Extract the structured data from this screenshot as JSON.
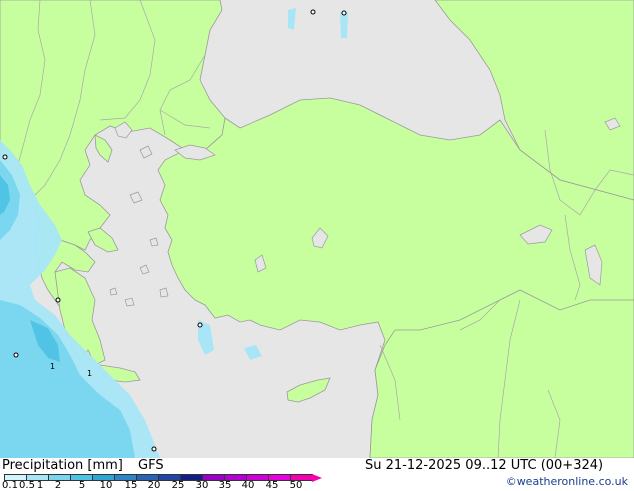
{
  "legend": {
    "title": "Precipitation [mm]",
    "model": "GFS",
    "valid_time": "Su 21-12-2025 09..12 UTC (00+324)",
    "credit": "©weatheronline.co.uk",
    "scale_labels": [
      "0.1",
      "0.5",
      "1",
      "2",
      "5",
      "10",
      "15",
      "20",
      "25",
      "30",
      "35",
      "40",
      "45",
      "50"
    ],
    "scale_colors": [
      "#d3f3ff",
      "#a8e6f7",
      "#78d6ee",
      "#4fc3e4",
      "#2fa6d6",
      "#2b86c8",
      "#2a63b6",
      "#2344a3",
      "#141e85",
      "#9a00c8",
      "#b400d0",
      "#d000d8",
      "#e800e0",
      "#f400b0"
    ]
  },
  "map_labels": {
    "markers": [
      "o",
      "o",
      "o",
      "o",
      "o",
      "o",
      "o",
      "1",
      "1"
    ]
  },
  "colors": {
    "land": "#c8ff9e",
    "sea": "#e6e6e6",
    "coastline": "#9a9a9a",
    "border": "#a8a8a8"
  }
}
